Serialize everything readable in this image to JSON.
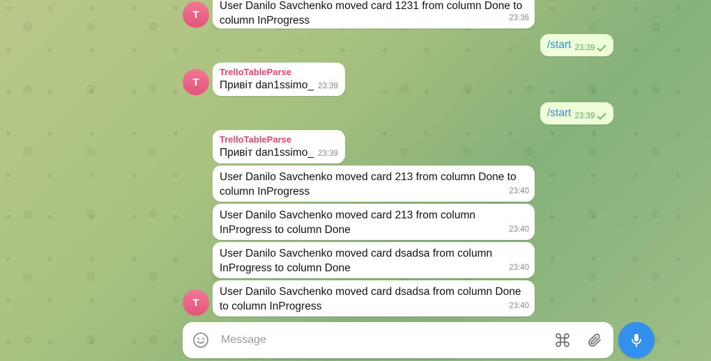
{
  "messages": [
    {
      "text": "User Danilo Savchenko moved card 1231 from column Done to column InProgress",
      "time": "23:36"
    },
    {
      "text": "/start",
      "time": "23:39"
    },
    {
      "sender": "TrelloTableParse",
      "text": "Привіт dan1ssimo_",
      "time": "23:39"
    },
    {
      "text": "/start",
      "time": "23:39"
    },
    {
      "sender": "TrelloTableParse",
      "text": "Привіт dan1ssimo_",
      "time": "23:39"
    },
    {
      "text": "User Danilo Savchenko moved card 213 from column Done to column InProgress",
      "time": "23:40"
    },
    {
      "text": "User Danilo Savchenko moved card 213 from column InProgress to column Done",
      "time": "23:40"
    },
    {
      "text": "User Danilo Savchenko moved card dsadsa from column InProgress to column Done",
      "time": "23:40"
    },
    {
      "text": "User Danilo Savchenko moved card dsadsa from column Done to column InProgress",
      "time": "23:40"
    }
  ],
  "avatar_letter": "T",
  "composer": {
    "placeholder": "Message"
  },
  "colors": {
    "accent": "#3390ec",
    "sender": "#e0446f",
    "outgoing_bg": "#eefed9",
    "check": "#5fae52"
  },
  "icons": {
    "emoji": "smiley-icon",
    "commands": "command-icon",
    "attach": "paperclip-icon",
    "voice": "microphone-icon"
  }
}
